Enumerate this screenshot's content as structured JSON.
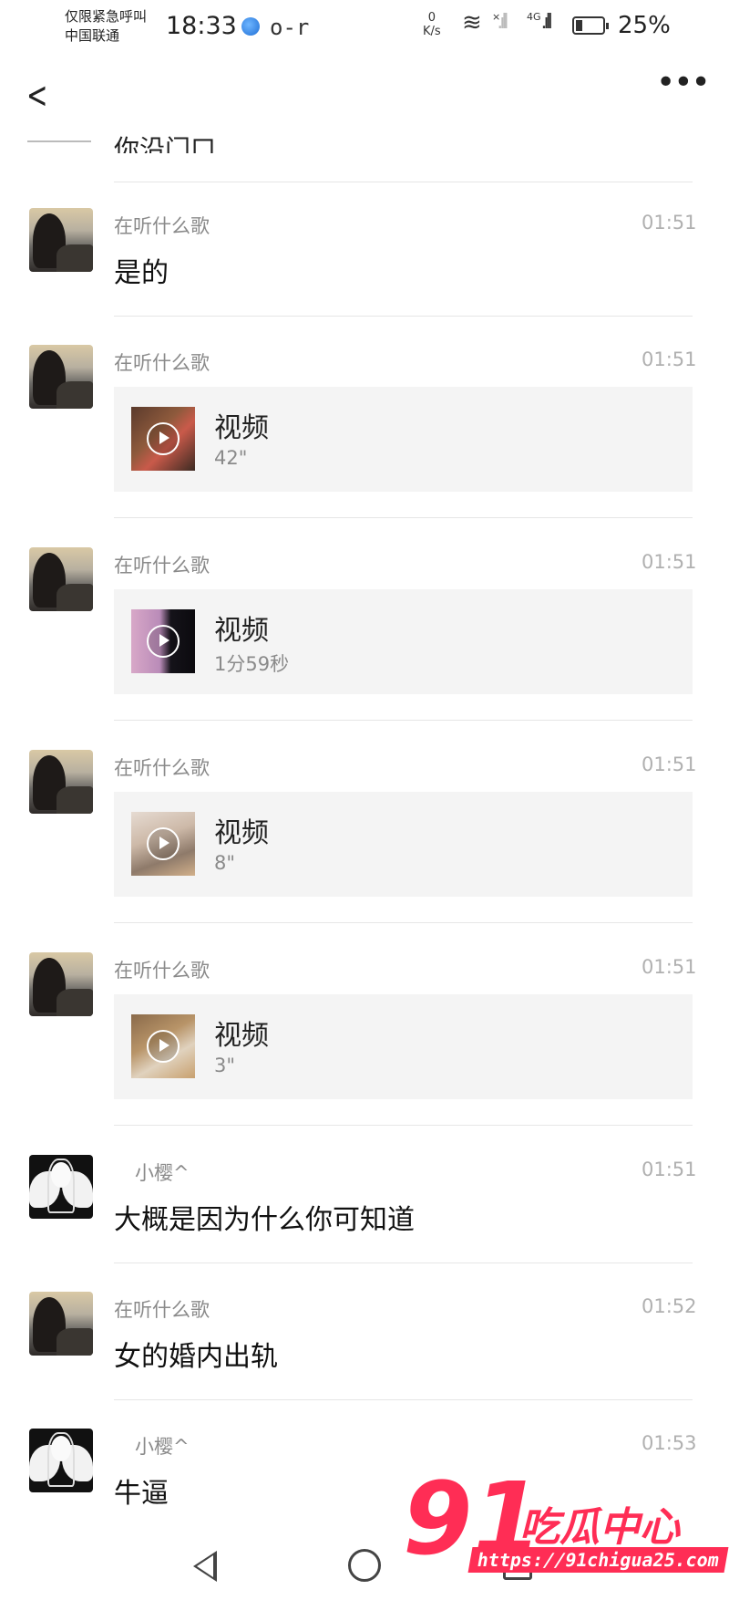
{
  "status_bar": {
    "carrier_line1": "仅限紧急呼叫",
    "carrier_line2": "中国联通",
    "time": "18:33",
    "speed_value": "0",
    "speed_unit": "K/s",
    "signal_label_1": "×",
    "signal_label_2": "4G",
    "battery_percent": "25%",
    "battery_level": 0.25
  },
  "nav": {
    "back_icon": "back-chevron-icon",
    "more_icon": "more-dots-icon"
  },
  "partial_message": "你沿门口",
  "messages": [
    {
      "sender": "在听什么歌",
      "time": "01:51",
      "text": "是的"
    },
    {
      "sender": "在听什么歌",
      "time": "01:51",
      "video": {
        "title": "视频",
        "duration": "42\""
      }
    },
    {
      "sender": "在听什么歌",
      "time": "01:51",
      "video": {
        "title": "视频",
        "duration": "1分59秒"
      }
    },
    {
      "sender": "在听什么歌",
      "time": "01:51",
      "video": {
        "title": "视频",
        "duration": "8\""
      }
    },
    {
      "sender": "在听什么歌",
      "time": "01:51",
      "video": {
        "title": "视频",
        "duration": "3\""
      }
    },
    {
      "sender": "小樱^",
      "time": "01:51",
      "text": "大概是因为什么你可知道"
    },
    {
      "sender": "在听什么歌",
      "time": "01:52",
      "text": "女的婚内出轨"
    },
    {
      "sender": "小樱^",
      "time": "01:53",
      "text": "牛逼"
    }
  ],
  "watermark": {
    "number": "91",
    "name": "吃瓜中心",
    "url": "https://91chigua25.com"
  },
  "colors": {
    "watermark": "#ff2d55",
    "card_bg": "#f4f4f4"
  }
}
